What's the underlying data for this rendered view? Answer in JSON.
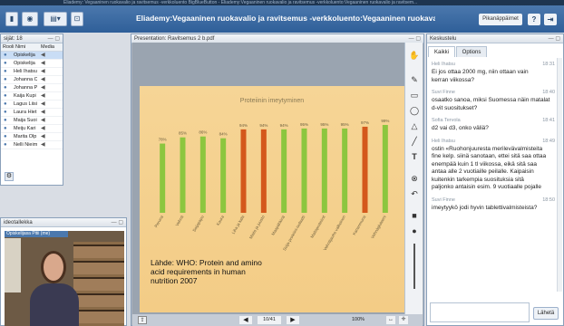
{
  "os_title": "Eliademy: Vegaaninen ruokavalio ja ravitsemus -verkkoluento    BigBlueButton - Eliademy:Vegaaninen ruokavalio ja ravitsemus -verkkoluento:Vegaaninen ruokavalio ja ravitsem...",
  "app_title": "Eliademy:Vegaaninen ruokavalio ja ravitsemus -verkkoluento:Vegaaninen ruokavalio ja ravitsemus -v...",
  "top_buttons": {
    "shortcuts": "Pikanäppäimet",
    "help": "?",
    "logout": "⇥"
  },
  "participants": {
    "header": "sijät: 18",
    "columns": [
      "Rooli",
      "Nimi",
      "Media"
    ],
    "rows": [
      {
        "name": "Opiskelija",
        "selected": true
      },
      {
        "name": "Opiskelija"
      },
      {
        "name": "Heli Ihatsu"
      },
      {
        "name": "Johanna C"
      },
      {
        "name": "Johanna P"
      },
      {
        "name": "Kaija Kupi"
      },
      {
        "name": "Lagus Liisi"
      },
      {
        "name": "Laura Hiet"
      },
      {
        "name": "Maija Suoi"
      },
      {
        "name": "Meiju Kari"
      },
      {
        "name": "Marita Olp"
      },
      {
        "name": "Nelli Nieim"
      }
    ]
  },
  "video": {
    "header": "ideotallekka",
    "name_tag": "Opiskelijasa Pitii (me)"
  },
  "presentation": {
    "header": "Presentation: Ravitsemus 2 b.pdf"
  },
  "chart_data": {
    "type": "bar",
    "title": "Proteiinin imeytyminen",
    "categories": [
      "Peruna",
      "Vehnä",
      "Soijapapu",
      "Kaura",
      "Liha ja kala",
      "Maito ja juusto",
      "Maapähkinä",
      "Soija-proteiini-isolaatti",
      "Maitoproteiinit",
      "Vehnäjauho valkoinen",
      "Kananmuna",
      "Vehnägluteeni"
    ],
    "values": [
      78,
      85,
      86,
      84,
      94,
      94,
      94,
      95,
      95,
      95,
      97,
      99
    ],
    "colors": [
      "#8cc63f",
      "#8cc63f",
      "#8cc63f",
      "#8cc63f",
      "#d4581c",
      "#d4581c",
      "#8cc63f",
      "#8cc63f",
      "#8cc63f",
      "#8cc63f",
      "#d4581c",
      "#8cc63f"
    ],
    "ylim": [
      0,
      100
    ],
    "source_lines": [
      "Lähde: WHO: Protein and amino",
      "acid requirements in human",
      "nutrition 2007"
    ]
  },
  "bottom_bar": {
    "page": "10/41",
    "zoom": "100%"
  },
  "chat": {
    "header": "Keskustelu",
    "tabs": [
      "Kaikki",
      "Options"
    ],
    "messages": [
      {
        "author": "Heli Ihatsu",
        "time": "18:31",
        "lines": [
          "Ei jos ottaa 2000 mg, niin ottaan vain",
          "kerran viikossa?"
        ]
      },
      {
        "author": "Suvi Finne",
        "time": "18:40",
        "lines": [
          "osaatko sanoa, miksi Suomessa näin matalat",
          "d-vit suositukset?"
        ]
      },
      {
        "author": "Sofia Tervola",
        "time": "18:41",
        "lines": [
          "d2 vai d3, onko väliä?"
        ]
      },
      {
        "author": "Heli Ihatsu",
        "time": "18:49",
        "lines": [
          "ostin «Ruohonjuuresta merilevävalmisteita",
          "fine kelp. siinä sanotaan, ettei sitä saa ottaa",
          "enempää kuin 1 tl viikossa, eikä sitä saa",
          "antaa alle 2 vuotiaille peilalle. Kaipaisin",
          "kuitenkin tarkempia suosituksia sitä",
          "paljonko antaisin esim. 9 vuotiaalle pojalle"
        ]
      },
      {
        "author": "Suvi Finne",
        "time": "18:50",
        "lines": [
          "imeytyykö jodi hyvin tablettivalmisteista?"
        ]
      }
    ],
    "send_label": "Lähetä"
  }
}
